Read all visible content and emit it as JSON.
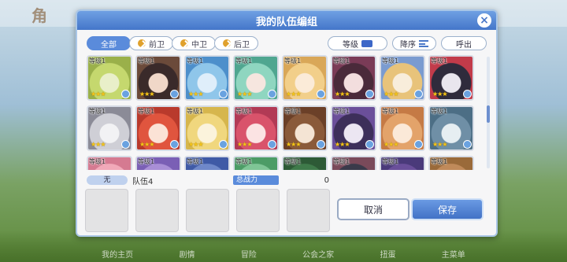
{
  "background": {
    "logo": "角",
    "bottom_nav": [
      "我的主页",
      "剧情",
      "冒险",
      "公会之家",
      "扭蛋",
      "主菜单"
    ]
  },
  "dialog": {
    "title": "我的队伍编组",
    "close_glyph": "×"
  },
  "filters": {
    "tabs": [
      {
        "label": "全部",
        "active": true
      },
      {
        "label": "前卫",
        "active": false
      },
      {
        "label": "中卫",
        "active": false
      },
      {
        "label": "后卫",
        "active": false
      }
    ],
    "sort_by": "等级",
    "order": "降序",
    "call": "呼出"
  },
  "roster": {
    "level_label": "等级1",
    "stars": "★★★",
    "cards": [
      {
        "colors": [
          "#e9efc9",
          "#c5d86e",
          "#9ab04a"
        ]
      },
      {
        "colors": [
          "#f0d7c8",
          "#3a2a2a",
          "#6b4a3a"
        ]
      },
      {
        "colors": [
          "#dfeefa",
          "#8fc6ea",
          "#4d8fcb"
        ]
      },
      {
        "colors": [
          "#f6e6df",
          "#8fd6c0",
          "#4fa690"
        ]
      },
      {
        "colors": [
          "#fbebd8",
          "#f2cf8a",
          "#d9a758"
        ]
      },
      {
        "colors": [
          "#f3dede",
          "#4a2a3a",
          "#7a3b57"
        ]
      },
      {
        "colors": [
          "#f8eddb",
          "#e8c37a",
          "#7a9bd0"
        ]
      },
      {
        "colors": [
          "#e9e6ee",
          "#2f2b3c",
          "#c23b4a"
        ]
      },
      {
        "colors": [
          "#f2f2f4",
          "#cfcfd6",
          "#8b8b97"
        ]
      },
      {
        "colors": [
          "#fbe3d6",
          "#e0553e",
          "#b93a2c"
        ]
      },
      {
        "colors": [
          "#fbf3dc",
          "#f0d77e",
          "#d6b64d"
        ]
      },
      {
        "colors": [
          "#fbe3e3",
          "#d9536b",
          "#b23a55"
        ]
      },
      {
        "colors": [
          "#f4e4d4",
          "#8a5a3a",
          "#6b4028"
        ]
      },
      {
        "colors": [
          "#ece6f2",
          "#3d2f5a",
          "#6b4f9a"
        ]
      },
      {
        "colors": [
          "#fbe9d8",
          "#e3a36a",
          "#c57a45"
        ]
      },
      {
        "colors": [
          "#e6eef2",
          "#6f8fa6",
          "#4c6e85"
        ]
      },
      {
        "colors": [
          "#fde6ea",
          "#f1a9b9",
          "#d57a91"
        ]
      },
      {
        "colors": [
          "#e9e3f3",
          "#a98fd6",
          "#7a5fb5"
        ]
      },
      {
        "colors": [
          "#e6ecf6",
          "#6f88c9",
          "#3f5aa6"
        ]
      },
      {
        "colors": [
          "#e6f3e9",
          "#7fc596",
          "#4c9c66"
        ]
      },
      {
        "colors": [
          "#e3f2e6",
          "#3f7a4a",
          "#2d5a36"
        ]
      },
      {
        "colors": [
          "#f2e6e6",
          "#3a3a4a",
          "#7a4a5a"
        ]
      },
      {
        "colors": [
          "#ece3f3",
          "#6a4f9a",
          "#4a3a7a"
        ]
      },
      {
        "colors": [
          "#f6e6da",
          "#c08a5a",
          "#9a6a3a"
        ]
      }
    ]
  },
  "team": {
    "leader_label": "无",
    "name": "队伍4",
    "power_label": "总战力",
    "power": "0"
  },
  "buttons": {
    "cancel": "取消",
    "save": "保存"
  }
}
